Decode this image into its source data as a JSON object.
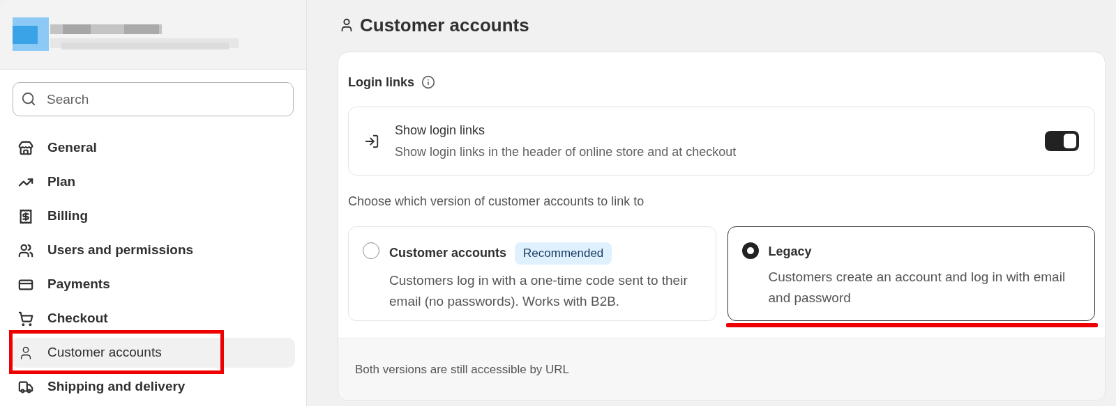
{
  "sidebar": {
    "search": {
      "placeholder": "Search"
    },
    "items": [
      {
        "label": "General",
        "selected": false,
        "highlighted": false
      },
      {
        "label": "Plan",
        "selected": false,
        "highlighted": false
      },
      {
        "label": "Billing",
        "selected": false,
        "highlighted": false
      },
      {
        "label": "Users and permissions",
        "selected": false,
        "highlighted": false
      },
      {
        "label": "Payments",
        "selected": false,
        "highlighted": false
      },
      {
        "label": "Checkout",
        "selected": false,
        "highlighted": false
      },
      {
        "label": "Customer accounts",
        "selected": true,
        "highlighted": true
      },
      {
        "label": "Shipping and delivery",
        "selected": false,
        "highlighted": false
      }
    ]
  },
  "page": {
    "title": "Customer accounts",
    "card": {
      "heading": "Login links",
      "setting": {
        "title": "Show login links",
        "description": "Show login links in the header of online store and at checkout",
        "on": true
      },
      "prompt": "Choose which version of customer accounts to link to",
      "options": [
        {
          "title": "Customer accounts",
          "badge": "Recommended",
          "description": "Customers log in with a one-time code sent to their email (no passwords). Works with B2B.",
          "selected": false,
          "highlighted": false
        },
        {
          "title": "Legacy",
          "description": "Customers create an account and log in with email and password",
          "selected": true,
          "highlighted": true
        }
      ],
      "footer": "Both versions are still accessible by URL"
    }
  }
}
